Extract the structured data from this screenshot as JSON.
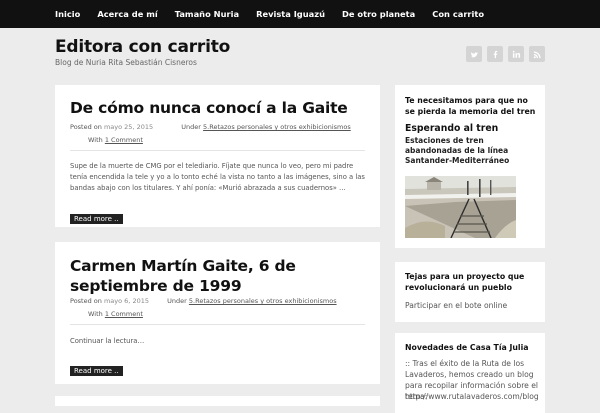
{
  "nav": {
    "items": [
      "Inicio",
      "Acerca de mí",
      "Tamaño Nuria",
      "Revista Iguazú",
      "De otro planeta",
      "Con carrito"
    ]
  },
  "site": {
    "title": "Editora con carrito",
    "description": "Blog de Nuria Rita Sebastián Cisneros"
  },
  "social": {
    "icons": [
      "twitter-icon",
      "facebook-icon",
      "linkedin-icon",
      "rss-icon"
    ]
  },
  "posts": [
    {
      "title": "De cómo nunca conocí a la Gaite",
      "posted_on": "Posted on",
      "date": "mayo 25, 2015",
      "under": "Under",
      "category": "5.Retazos personales y otros exhibicionismos",
      "with": "With",
      "comments": "1 Comment",
      "excerpt": "Supe de la muerte de CMG por el telediario. Fíjate que nunca lo veo, pero mi padre tenía encendida la tele y yo a lo tonto eché la vista no tanto a las imágenes, sino a las bandas abajo con los titulares. Y ahí ponía: «Murió abrazada a sus cuadernos» …",
      "read_more": "Read more .."
    },
    {
      "title": "Carmen Martín Gaite, 6 de septiembre de 1999",
      "posted_on": "Posted on",
      "date": "mayo 6, 2015",
      "under": "Under",
      "category": "5.Retazos personales y otros exhibicionismos",
      "with": "With",
      "comments": "1 Comment",
      "excerpt": "Continuar la lectura…",
      "read_more": "Read more .."
    }
  ],
  "sidebar": {
    "w1": {
      "title": "Te necesitamos para que no se pierda la memoria del tren",
      "subtitle": "Esperando al tren",
      "caption": "Estaciones de tren abandonadas de la línea Santander-Mediterráneo"
    },
    "w2": {
      "title": "Tejas para un proyecto que revolucionará un pueblo",
      "text": "Participar en el bote online"
    },
    "w3": {
      "title": "Novedades de Casa Tía Julia",
      "text": ":: Tras el éxito de la Ruta de los Lavaderos, hemos creado un blog para recopilar información sobre el tema:",
      "link": "http://www.rutalavaderos.com/blog"
    }
  },
  "colors": {
    "topbar": "#111111",
    "page_bg": "#ececec",
    "card_bg": "#ffffff",
    "button_bg": "#222222"
  }
}
